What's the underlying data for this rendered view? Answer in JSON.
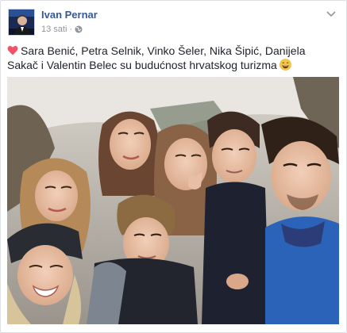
{
  "post": {
    "author": "Ivan Pernar",
    "time": "13 sati",
    "separator": "·",
    "privacy_icon": "globe-icon",
    "menu_icon": "chevron-down-icon",
    "caption": {
      "emoji_start": "heart-icon",
      "text": "Sara Benić, Petra Selnik, Vinko Šeler, Nika Šipić, Danijela Sakač i Valentin Belec su budućnost hrvatskog turizma",
      "emoji_end": "laugh-icon"
    },
    "photo": {
      "icon": "group-selfie-photo"
    }
  },
  "colors": {
    "link": "#365899",
    "meta": "#90949c",
    "text": "#1d2129",
    "border": "#dddfe2",
    "heart": "#f25268",
    "emoji": "#f7c643"
  }
}
